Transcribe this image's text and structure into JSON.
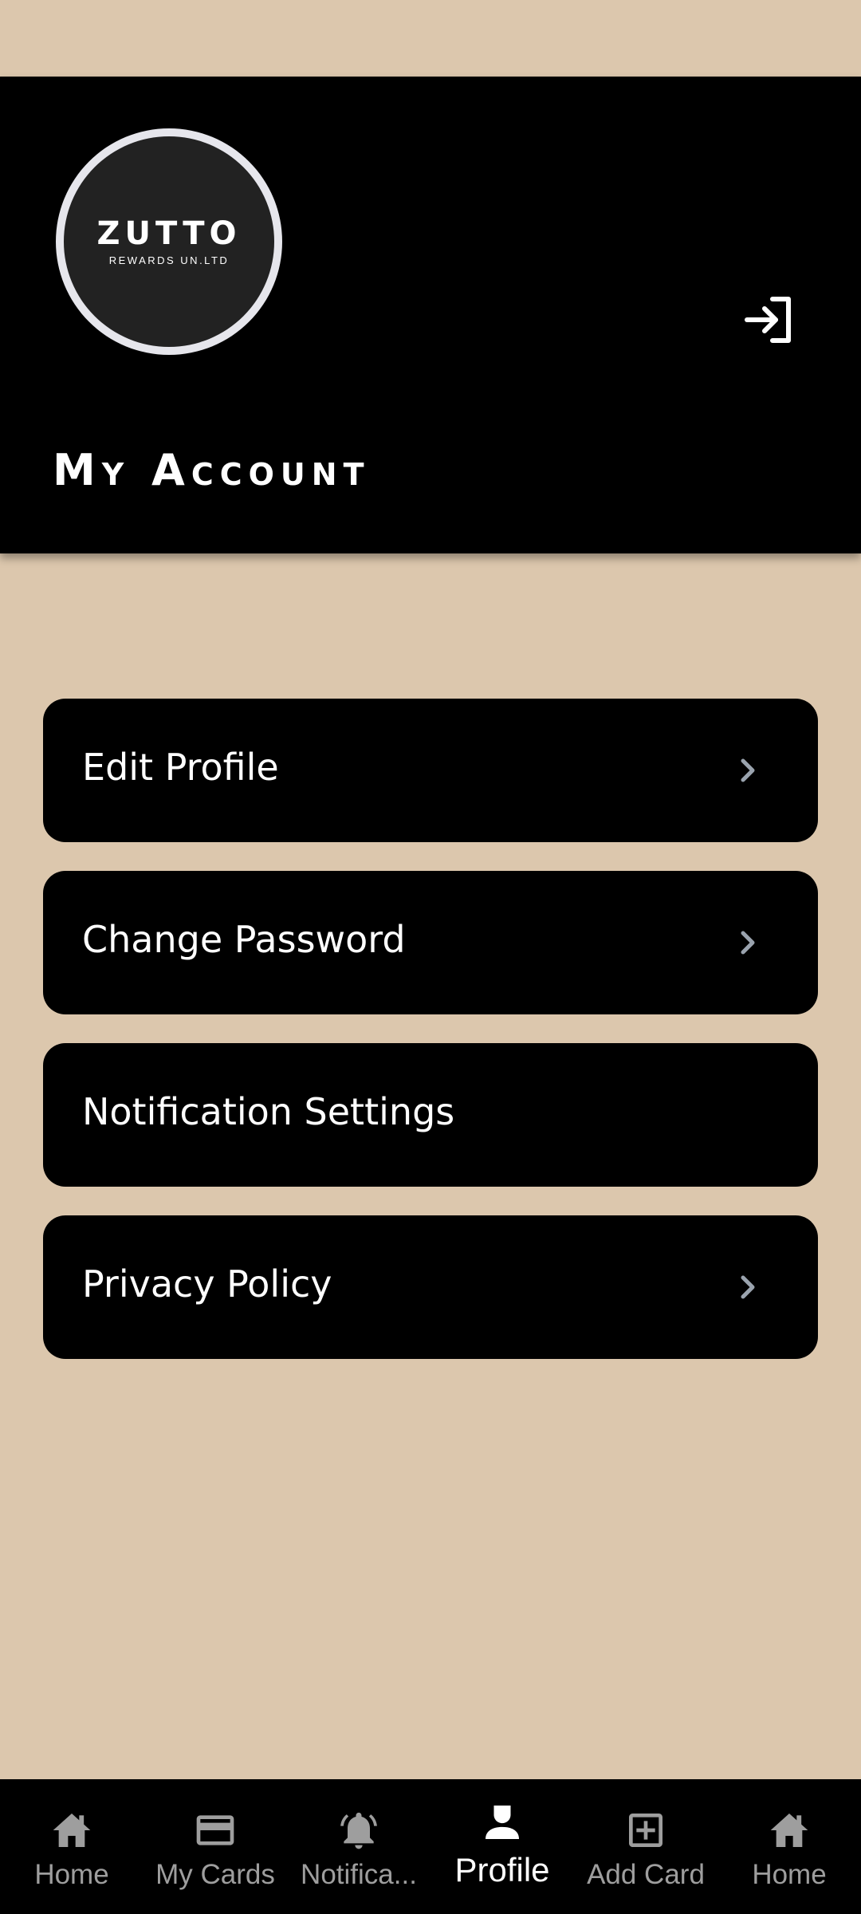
{
  "header": {
    "logo": {
      "name": "ZUTTO",
      "subtitle": "REWARDS UN.LTD"
    },
    "title": "My Account",
    "logout_icon": "logout-icon"
  },
  "menu": {
    "items": [
      {
        "label": "Edit Profile",
        "has_chevron": true
      },
      {
        "label": "Change Password",
        "has_chevron": true
      },
      {
        "label": "Notification Settings",
        "has_chevron": false
      },
      {
        "label": "Privacy Policy",
        "has_chevron": true
      }
    ]
  },
  "nav": {
    "active_index": 3,
    "items": [
      {
        "label": "Home",
        "icon": "home-icon"
      },
      {
        "label": "My Cards",
        "icon": "card-icon"
      },
      {
        "label": "Notifica...",
        "icon": "bell-icon"
      },
      {
        "label": "Profile",
        "icon": "person-icon"
      },
      {
        "label": "Add Card",
        "icon": "add-box-icon"
      },
      {
        "label": "Home",
        "icon": "home-icon"
      }
    ]
  },
  "colors": {
    "background": "#DCC7AD",
    "header": "#000000",
    "nav_inactive": "#9E9E9E",
    "nav_active": "#FFFFFF"
  }
}
